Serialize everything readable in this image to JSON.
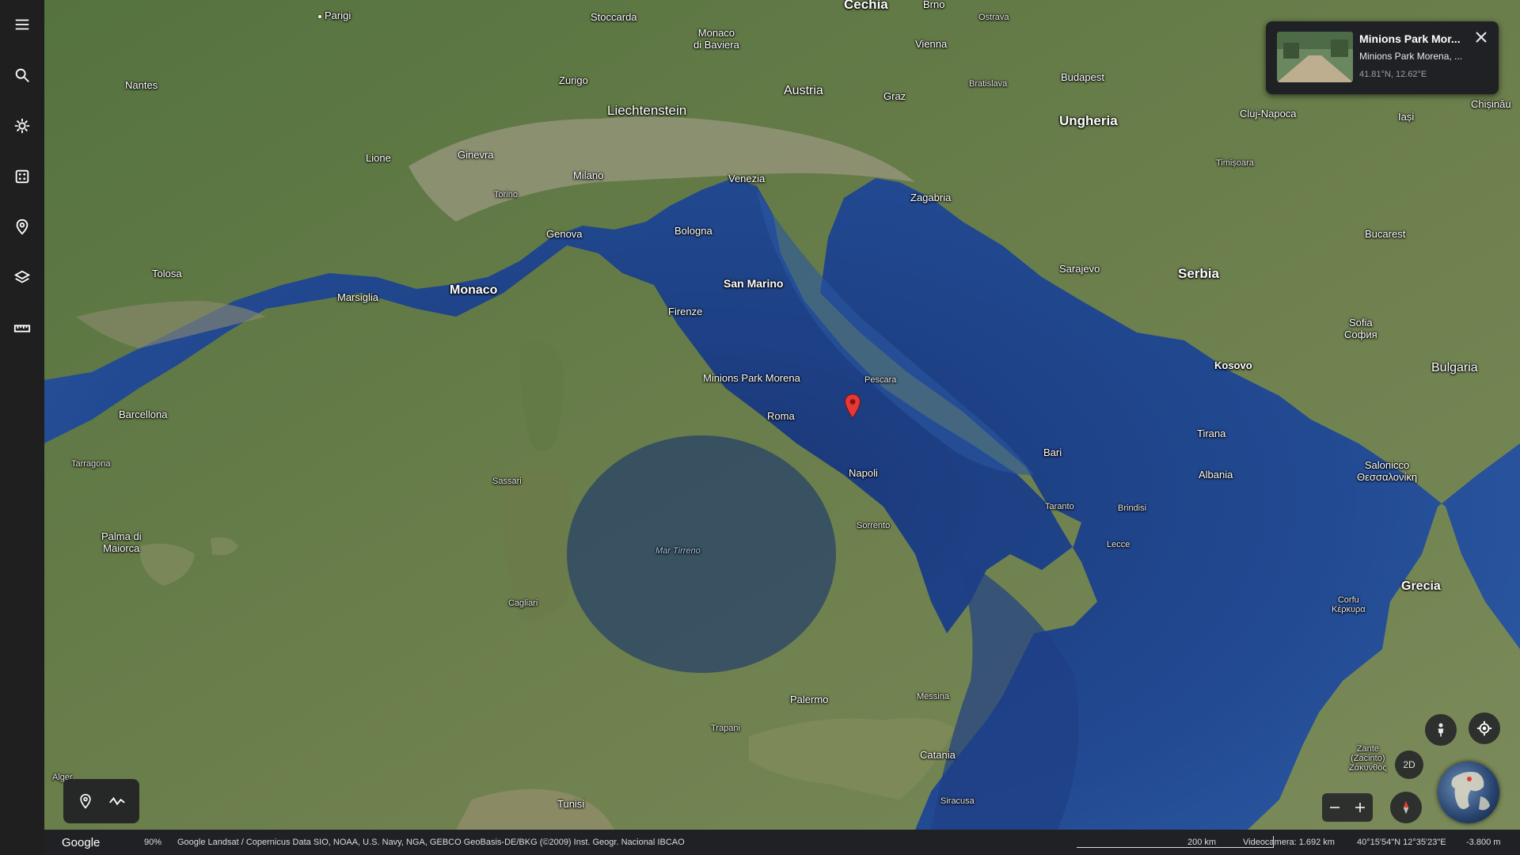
{
  "rail": {
    "items": [
      "menu-icon",
      "search-icon",
      "voyager-icon",
      "dice-icon",
      "projects-icon",
      "layers-icon",
      "measure-icon"
    ]
  },
  "map": {
    "labels": {
      "cechia": "Cechia",
      "brno": "Brno",
      "parigi": "Parigi",
      "stoccarda": "Stoccarda",
      "monaco_baviera": "Monaco\ndi Baviera",
      "vienna": "Vienna",
      "ostrava": "Ostrava",
      "budapest": "Budapest",
      "nantes": "Nantes",
      "zurigo": "Zurigo",
      "liechtenstein": "Liechtenstein",
      "austria": "Austria",
      "graz": "Graz",
      "bratislava": "Bratislava",
      "ungheria": "Ungheria",
      "cluj": "Cluj-Napoca",
      "iasi": "Iași",
      "chisinau": "Chișinău",
      "ginevra": "Ginevra",
      "lione": "Lione",
      "milano": "Milano",
      "venezia": "Venezia",
      "torino": "Torino",
      "timisoara": "Timișoara",
      "zagabria": "Zagabria",
      "genova": "Genova",
      "bologna": "Bologna",
      "bucarest": "Bucarest",
      "tolosa": "Tolosa",
      "marsiglia": "Marsiglia",
      "monaco": "Monaco",
      "san_marino": "San Marino",
      "sarajevo": "Sarajevo",
      "serbia": "Serbia",
      "firenze": "Firenze",
      "sofia": "Sofia\nСофия",
      "minions": "Minions Park Morena",
      "kosovo": "Kosovo",
      "bulgaria": "Bulgaria",
      "barcellona": "Barcellona",
      "roma": "Roma",
      "bari": "Bari",
      "tirana": "Tirana",
      "albania": "Albania",
      "napoli": "Napoli",
      "salonicco": "Salonicco\nΘεσσαλονίκη",
      "palma": "Palma di\nMaiorca",
      "mar_tirreno": "Mar Tirreno",
      "grecia": "Grecia",
      "palermo": "Palermo",
      "catania": "Catania",
      "tunisi": "Tunisi",
      "tarragona": "Tarragona",
      "cagliari": "Cagliari",
      "pescara": "Pescara",
      "lecce": "Lecce",
      "sorrento": "Sorrento",
      "messina": "Messina",
      "trapani": "Trapani",
      "taranto": "Taranto",
      "brindisi": "Brindisi",
      "sassari": "Sassari",
      "siracusa": "Siracusa",
      "corfu": "Corfu\nΚέρκυρα",
      "zante": "Zante\n(Zacinto)\nΖάκυνθος",
      "alger": "Alger"
    }
  },
  "card": {
    "title": "Minions Park Mor...",
    "subtitle": "Minions Park Morena, ...",
    "coords": "41.81°N, 12.62°E"
  },
  "controls": {
    "mode_2d": "2D"
  },
  "status": {
    "brand": "Google",
    "percent": "90%",
    "credits": "Google   Landsat / Copernicus   Data SIO, NOAA, U.S. Navy, NGA, GEBCO   GeoBasis-DE/BKG (©2009)   Inst. Geogr. Nacional   IBCAO",
    "scale_label": "200 km",
    "camera": "Videocamera: 1.692 km",
    "location": "40°15'54\"N 12°35'23\"E",
    "altitude": "-3.800 m"
  },
  "colors": {
    "sea_deep": "#1d3f82",
    "sea_shallow": "#3f6cb3",
    "land": "#5d7a45",
    "land_dry": "#7f8c5c",
    "mountain": "#a3a28c",
    "pin": "#e53935",
    "rail_bg": "#1f1f1f",
    "panel_bg": "#202124"
  }
}
